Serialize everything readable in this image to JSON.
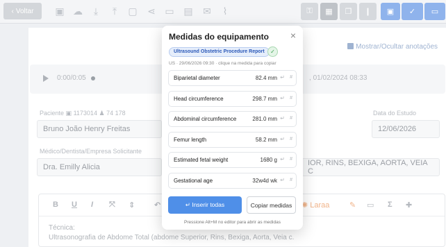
{
  "toolbar": {
    "back_label": "Voltar",
    "icons": [
      "image-icon",
      "cloud-upload-icon",
      "download-icon",
      "upload-icon",
      "image-frame-icon",
      "share-icon",
      "folder-icon",
      "gallery-icon",
      "mail-icon",
      "paperclip-icon"
    ],
    "accent": "#8fb3ec"
  },
  "page": {
    "annotations_toggle": "Mostrar/Ocultar anotações",
    "audio": {
      "time": "0:00/0:05",
      "recorded_at": "01/02/2024 08:33"
    },
    "patient": {
      "label": "Paciente",
      "id_number": "1173014",
      "age": "74 178",
      "name": "Bruno João Henry Freitas"
    },
    "exam_date": {
      "label": "Data do Estudo",
      "value": "12/06/2026"
    },
    "doctor": {
      "label": "Médico/Dentista/Empresa Solicitante",
      "value": "Dra. Emilly Alicia"
    },
    "exam_type": "IOR, RINS, BEXIGA, AORTA, VEIA C",
    "editor": {
      "tools": [
        "B",
        "U",
        "I",
        "⤧",
        "⇕",
        "↶"
      ],
      "laraa_label": "Laraa",
      "line1": "Técnica:",
      "line2": "Ultrasonografia de Abdome Total (abdome Superior, Rins, Bexiga, Aorta, Veia c."
    }
  },
  "modal": {
    "title": "Medidas do equipamento",
    "close": "×",
    "report_badge": "Ultrasound Obstetric Procedure Report",
    "verified": "✓",
    "meta": "US · 29/06/2026 09:30 · clique na medida para copiar",
    "measurements": [
      {
        "name": "Biparietal diameter",
        "value": "82.4 mm"
      },
      {
        "name": "Head circumference",
        "value": "298.7 mm"
      },
      {
        "name": "Abdominal circumference",
        "value": "281.0 mm"
      },
      {
        "name": "Femur length",
        "value": "58.2 mm"
      },
      {
        "name": "Estimated fetal weight",
        "value": "1680 g"
      },
      {
        "name": "Gestational age",
        "value": "32w4d wk"
      }
    ],
    "insert_glyph": "↵",
    "hash_glyph": "#",
    "insert_all": "↵ Inserir todas",
    "copy_all": "Copiar medidas",
    "hint": "Pressione Alt+M no editor para abrir as medidas"
  }
}
